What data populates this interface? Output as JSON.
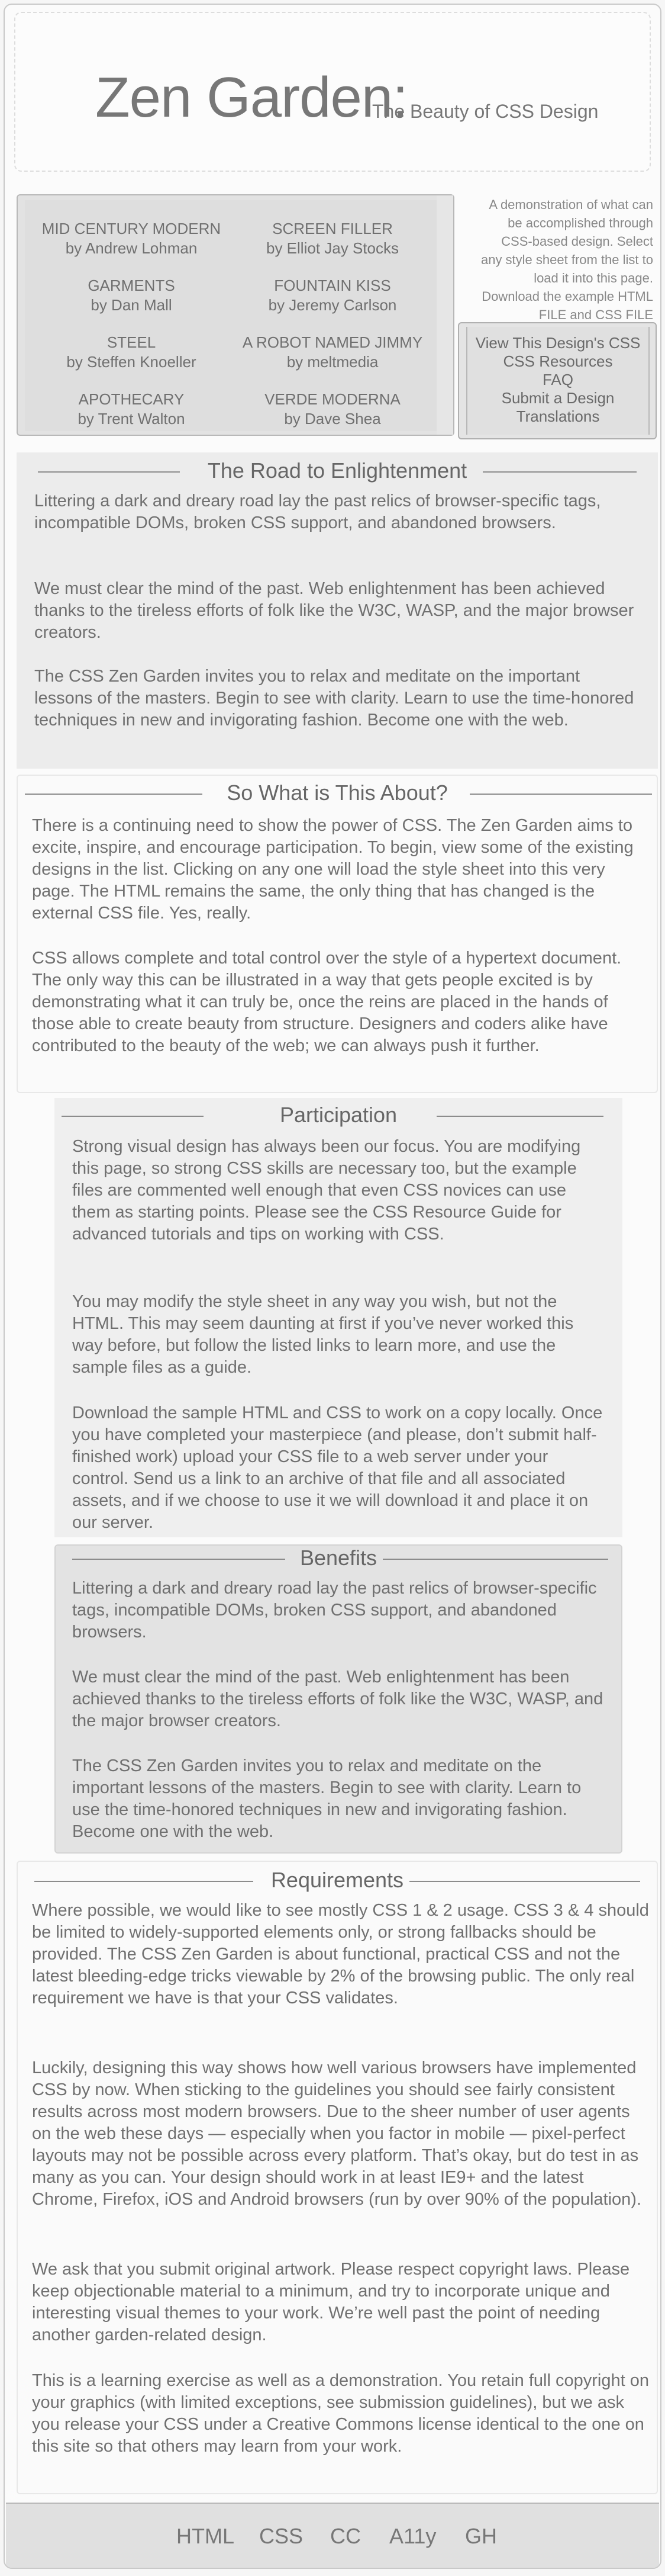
{
  "header": {
    "title": "Zen Garden:",
    "tagline": "The Beauty of CSS Design"
  },
  "designs": [
    {
      "name": "MID CENTURY MODERN",
      "author": "by Andrew Lohman"
    },
    {
      "name": "SCREEN FILLER",
      "author": "by Elliot Jay Stocks"
    },
    {
      "name": "GARMENTS",
      "author": "by Dan Mall"
    },
    {
      "name": "FOUNTAIN KISS",
      "author": "by Jeremy Carlson"
    },
    {
      "name": "STEEL",
      "author": "by Steffen Knoeller"
    },
    {
      "name": "A ROBOT NAMED JIMMY",
      "author": "by meltmedia"
    },
    {
      "name": "APOTHECARY",
      "author": "by Trent Walton"
    },
    {
      "name": "VERDE MODERNA",
      "author": "by Dave Shea"
    }
  ],
  "select_text": {
    "line1": "A demonstration of what can",
    "line2": "be accomplished through",
    "line3": "CSS-based design. Select",
    "line4": "any style sheet from the list to",
    "line5": "load it into this page.",
    "line6": "Download the example HTML",
    "line7": "FILE and CSS FILE"
  },
  "resources": {
    "links": [
      "View This Design's CSS",
      "CSS Resources",
      "FAQ",
      "Submit a Design",
      "Translations"
    ]
  },
  "sections": {
    "road": {
      "heading": "The Road to Enlightenment",
      "paragraphs": [
        "Littering a dark and dreary road lay the past relics of browser-specific tags, incompatible DOMs, broken CSS support, and abandoned browsers.",
        "We must clear the mind of the past. Web enlightenment has been achieved thanks to the tireless efforts of folk like the W3C, WASP, and the major browser creators.",
        "The CSS Zen Garden invites you to relax and meditate on the important lessons of the masters. Begin to see with clarity. Learn to use the time-honored techniques in new and invigorating fashion. Become one with the web."
      ]
    },
    "about": {
      "heading": "So What is This About?",
      "paragraphs": [
        "There is a continuing need to show the power of CSS. The Zen Garden aims to excite, inspire, and encourage participation. To begin, view some of the existing designs in the list. Clicking on any one will load the style sheet into this very page. The HTML remains the same, the only thing that has changed is the external CSS file. Yes, really.",
        "CSS allows complete and total control over the style of a hypertext document. The only way this can be illustrated in a way that gets people excited is by demonstrating what it can truly be, once the reins are placed in the hands of those able to create beauty from structure. Designers and coders alike have contributed to the beauty of the web; we can always push it further."
      ]
    },
    "participation": {
      "heading": "Participation",
      "paragraphs": [
        "Strong visual design has always been our focus. You are modifying this page, so strong CSS skills are necessary too, but the example files are commented well enough that even CSS novices can use them as starting points. Please see the CSS Resource Guide for advanced tutorials and tips on working with CSS.",
        "You may modify the style sheet in any way you wish, but not the HTML. This may seem daunting at first if you’ve never worked this way before, but follow the listed links to learn more, and use the sample files as a guide.",
        "Download the sample HTML and CSS to work on a copy locally. Once you have completed your masterpiece (and please, don’t submit half-finished work) upload your CSS file to a web server under your control. Send us a link to an archive of that file and all associated assets, and if we choose to use it we will download it and place it on our server."
      ]
    },
    "benefits": {
      "heading": "Benefits",
      "paragraphs": [
        "Littering a dark and dreary road lay the past relics of browser-specific tags, incompatible DOMs, broken CSS support, and abandoned browsers.",
        "We must clear the mind of the past. Web enlightenment has been achieved thanks to the tireless efforts of folk like the W3C, WASP, and the major browser creators.",
        "The CSS Zen Garden invites you to relax and meditate on the important lessons of the masters. Begin to see with clarity. Learn to use the time-honored techniques in new and invigorating fashion. Become one with the web."
      ]
    },
    "requirements": {
      "heading": "Requirements",
      "paragraphs": [
        "Where possible, we would like to see mostly CSS 1 & 2 usage. CSS 3 & 4 should be limited to widely-supported elements only, or strong fallbacks should be provided. The CSS Zen Garden is about functional, practical CSS and not the latest bleeding-edge tricks viewable by 2% of the browsing public. The only real requirement we have is that your CSS validates.",
        "Luckily, designing this way shows how well various browsers have implemented CSS by now. When sticking to the guidelines you should see fairly consistent results across most modern browsers. Due to the sheer number of user agents on the web these days — especially when you factor in mobile — pixel-perfect layouts may not be possible across every platform. That’s okay, but do test in as many as you can. Your design should work in at least IE9+ and the latest Chrome, Firefox, iOS and Android browsers (run by over 90% of the population).",
        "We ask that you submit original artwork. Please respect copyright laws. Please keep objectionable material to a minimum, and try to incorporate unique and interesting visual themes to your work. We’re well past the point of needing another garden-related design.",
        "This is a learning exercise as well as a demonstration. You retain full copyright on your graphics (with limited exceptions, see submission guidelines), but we ask you release your CSS under a Creative Commons license identical to the one on this site so that others may learn from your work."
      ]
    }
  },
  "footer": {
    "links": [
      "HTML",
      "CSS",
      "CC",
      "A11y",
      "GH"
    ]
  }
}
